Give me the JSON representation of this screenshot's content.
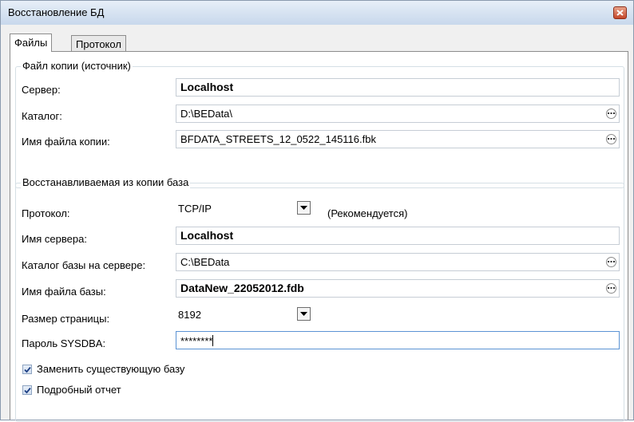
{
  "window": {
    "title": "Восстановление БД"
  },
  "tabs": [
    {
      "label": "Файлы",
      "active": true
    },
    {
      "label": "Протокол",
      "active": false
    }
  ],
  "source": {
    "group_title": "Файл копии (источник)",
    "server_label": "Сервер:",
    "server_value": "Localhost",
    "catalog_label": "Каталог:",
    "catalog_value": "D:\\BEData\\",
    "filename_label": "Имя файла копии:",
    "filename_value": "BFDATA_STREETS_12_0522_145116.fbk"
  },
  "target": {
    "group_title": "Восстанавливаемая из копии база",
    "protocol_label": "Протокол:",
    "protocol_value": "TCP/IP",
    "protocol_note": "(Рекомендуется)",
    "server_name_label": "Имя сервера:",
    "server_name_value": "Localhost",
    "db_catalog_label": "Каталог базы на сервере:",
    "db_catalog_value": "C:\\BEData",
    "db_filename_label": "Имя файла базы:",
    "db_filename_value": "DataNew_22052012.fdb",
    "page_size_label": "Размер страницы:",
    "page_size_value": "8192",
    "password_label": "Пароль SYSDBA:",
    "password_value": "********"
  },
  "options": {
    "replace_existing": {
      "label": "Заменить существующую базу",
      "checked": true
    },
    "verbose_report": {
      "label": "Подробный отчет",
      "checked": true
    }
  },
  "icons": {
    "close": "close-icon",
    "browse": "ellipsis-icon",
    "dropdown": "chevron-down-icon",
    "check": "checkmark-icon"
  },
  "colors": {
    "accent_border": "#5b93d4",
    "close_button": "#c4472a",
    "check_mark": "#1c3f84"
  }
}
